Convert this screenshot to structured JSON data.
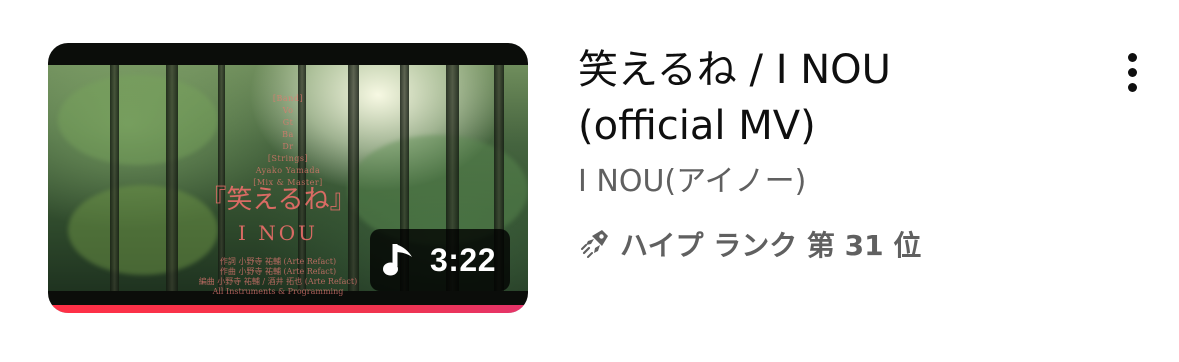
{
  "video": {
    "title": "笑えるね / I NOU (official MV)",
    "channel": "I NOU(アイノー)",
    "hype_rank": "ハイプ ランク 第 31 位",
    "duration": "3:22",
    "watch_progress_fraction": 1.0,
    "accent_color": "#ff3046",
    "icons": {
      "duration": "music-note-icon",
      "hype": "hype-rocket-icon",
      "menu": "more-vert-icon"
    }
  },
  "thumbnail": {
    "credits_top": [
      "[Band]",
      "Vo",
      "Gt",
      "Ba",
      "Dr",
      "[Strings]",
      "Ayako Yamada",
      "[Mix & Master]"
    ],
    "title_text": "『笑えるね』",
    "artist_text": "I  NOU",
    "credits_bottom": [
      "作詞 小野寺 祐輔 (Arte Refact)",
      "作曲 小野寺 祐輔 (Arte Refact)",
      "編曲 小野寺 祐輔 / 酒井 拓也 (Arte Refact)",
      "All Instruments & Programming"
    ]
  }
}
